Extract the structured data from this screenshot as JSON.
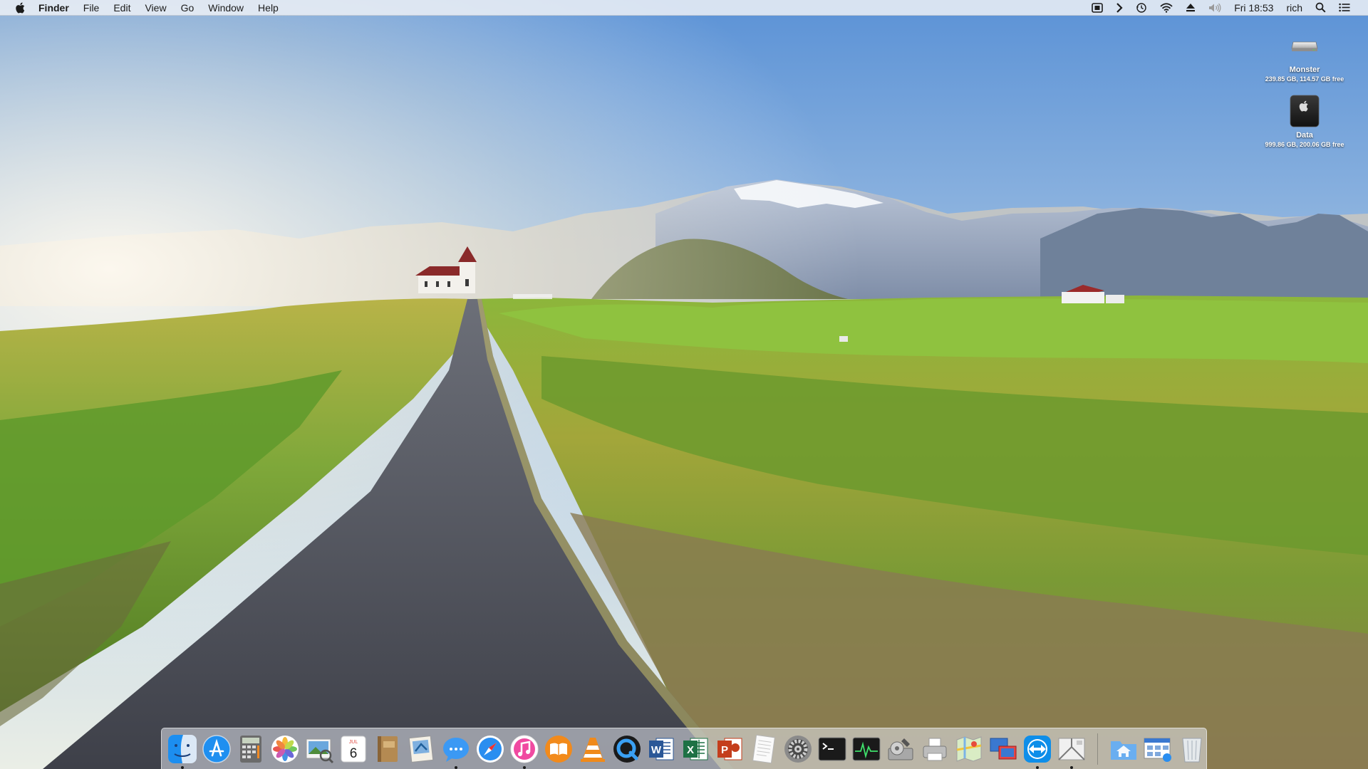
{
  "menubar": {
    "app_name": "Finder",
    "items": [
      "File",
      "Edit",
      "View",
      "Go",
      "Window",
      "Help"
    ],
    "status_icons": [
      "screen-capture-icon",
      "dictation-chevron-icon",
      "time-machine-icon",
      "wifi-icon",
      "eject-icon",
      "volume-icon"
    ],
    "clock": "Fri 18:53",
    "user": "rich"
  },
  "desktop_icons": [
    {
      "name": "Monster",
      "info": "239.85 GB, 114.57 GB free",
      "icon": "internal-drive-icon"
    },
    {
      "name": "Data",
      "info": "999.86 GB, 200.06 GB free",
      "icon": "external-drive-icon"
    }
  ],
  "dock": {
    "apps": [
      {
        "name": "Finder",
        "icon": "finder-icon",
        "running": true
      },
      {
        "name": "App Store",
        "icon": "app-store-icon",
        "running": false
      },
      {
        "name": "Calculator",
        "icon": "calculator-icon",
        "running": false
      },
      {
        "name": "Photos",
        "icon": "photos-icon",
        "running": false
      },
      {
        "name": "Preview",
        "icon": "preview-icon",
        "running": false
      },
      {
        "name": "Calendar",
        "icon": "calendar-icon",
        "running": false,
        "month": "JUL",
        "day": "6"
      },
      {
        "name": "Notebook",
        "icon": "notebook-icon",
        "running": false
      },
      {
        "name": "Mail",
        "icon": "mail-icon",
        "running": false
      },
      {
        "name": "Messages",
        "icon": "messages-icon",
        "running": true
      },
      {
        "name": "Safari",
        "icon": "safari-icon",
        "running": false
      },
      {
        "name": "iTunes",
        "icon": "itunes-icon",
        "running": true
      },
      {
        "name": "iBooks",
        "icon": "ibooks-icon",
        "running": false
      },
      {
        "name": "VLC",
        "icon": "vlc-icon",
        "running": false
      },
      {
        "name": "QuickTime Player",
        "icon": "quicktime-icon",
        "running": false
      },
      {
        "name": "Microsoft Word",
        "icon": "word-icon",
        "running": false,
        "letter": "W"
      },
      {
        "name": "Microsoft Excel",
        "icon": "excel-icon",
        "running": false,
        "letter": "X"
      },
      {
        "name": "Microsoft PowerPoint",
        "icon": "powerpoint-icon",
        "running": false,
        "letter": "P"
      },
      {
        "name": "TextEdit",
        "icon": "textedit-icon",
        "running": false
      },
      {
        "name": "System Preferences",
        "icon": "system-preferences-icon",
        "running": false
      },
      {
        "name": "Terminal",
        "icon": "terminal-icon",
        "running": false
      },
      {
        "name": "Activity Monitor",
        "icon": "activity-monitor-icon",
        "running": false
      },
      {
        "name": "Disk Utility",
        "icon": "disk-utility-icon",
        "running": false
      },
      {
        "name": "Printer",
        "icon": "printer-icon",
        "running": false
      },
      {
        "name": "Maps",
        "icon": "maps-icon",
        "running": false
      },
      {
        "name": "Remote Desktop",
        "icon": "remote-desktop-icon",
        "running": false
      },
      {
        "name": "TeamViewer",
        "icon": "teamviewer-icon",
        "running": true
      },
      {
        "name": "Directory Utility",
        "icon": "directory-utility-icon",
        "running": true
      }
    ],
    "folders": [
      {
        "name": "Home",
        "icon": "home-folder-icon"
      },
      {
        "name": "Applications",
        "icon": "applications-window-icon"
      },
      {
        "name": "Trash",
        "icon": "trash-icon"
      }
    ]
  },
  "colors": {
    "menubar_bg": "#ECF0F6",
    "sky_top": "#5f97d8",
    "grass": "#7fa83a",
    "road": "#4a4d55"
  }
}
